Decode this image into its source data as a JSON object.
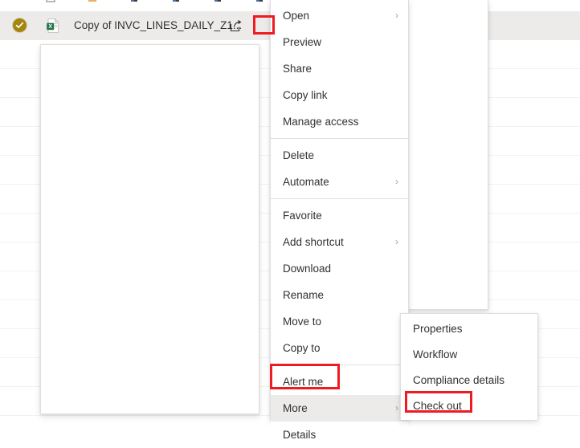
{
  "app": {
    "accent_selected_row_bg": "#edebe9",
    "highlight_color": "#ee1b22",
    "checked_out_badge_color": "#a4860b"
  },
  "file_row": {
    "status_icon": "checkmark-circle-icon",
    "file_type_icon": "excel-file-icon",
    "name": "Copy of INVC_LINES_DAILY_Z1...",
    "share_icon": "share-icon",
    "more_actions_icon": "ellipsis-icon"
  },
  "context_menu": {
    "items": [
      {
        "label": "Open",
        "submenu": true,
        "separator_after": false,
        "highlighted": false
      },
      {
        "label": "Preview",
        "submenu": false,
        "separator_after": false,
        "highlighted": false
      },
      {
        "label": "Share",
        "submenu": false,
        "separator_after": false,
        "highlighted": false
      },
      {
        "label": "Copy link",
        "submenu": false,
        "separator_after": false,
        "highlighted": false
      },
      {
        "label": "Manage access",
        "submenu": false,
        "separator_after": true,
        "highlighted": false
      },
      {
        "label": "Delete",
        "submenu": false,
        "separator_after": false,
        "highlighted": false
      },
      {
        "label": "Automate",
        "submenu": true,
        "separator_after": true,
        "highlighted": false
      },
      {
        "label": "Favorite",
        "submenu": false,
        "separator_after": false,
        "highlighted": false
      },
      {
        "label": "Add shortcut",
        "submenu": true,
        "separator_after": false,
        "highlighted": false
      },
      {
        "label": "Download",
        "submenu": false,
        "separator_after": false,
        "highlighted": false
      },
      {
        "label": "Rename",
        "submenu": false,
        "separator_after": false,
        "highlighted": false
      },
      {
        "label": "Move to",
        "submenu": false,
        "separator_after": false,
        "highlighted": false
      },
      {
        "label": "Copy to",
        "submenu": false,
        "separator_after": true,
        "highlighted": false
      },
      {
        "label": "Alert me",
        "submenu": false,
        "separator_after": false,
        "highlighted": false
      },
      {
        "label": "More",
        "submenu": true,
        "separator_after": false,
        "highlighted": true
      },
      {
        "label": "Details",
        "submenu": false,
        "separator_after": false,
        "highlighted": false
      }
    ]
  },
  "more_submenu": {
    "items": [
      {
        "label": "Properties",
        "highlighted": false
      },
      {
        "label": "Workflow",
        "highlighted": false
      },
      {
        "label": "Compliance details",
        "highlighted": false
      },
      {
        "label": "Check out",
        "highlighted": false
      }
    ]
  },
  "chevron_glyph": "›"
}
